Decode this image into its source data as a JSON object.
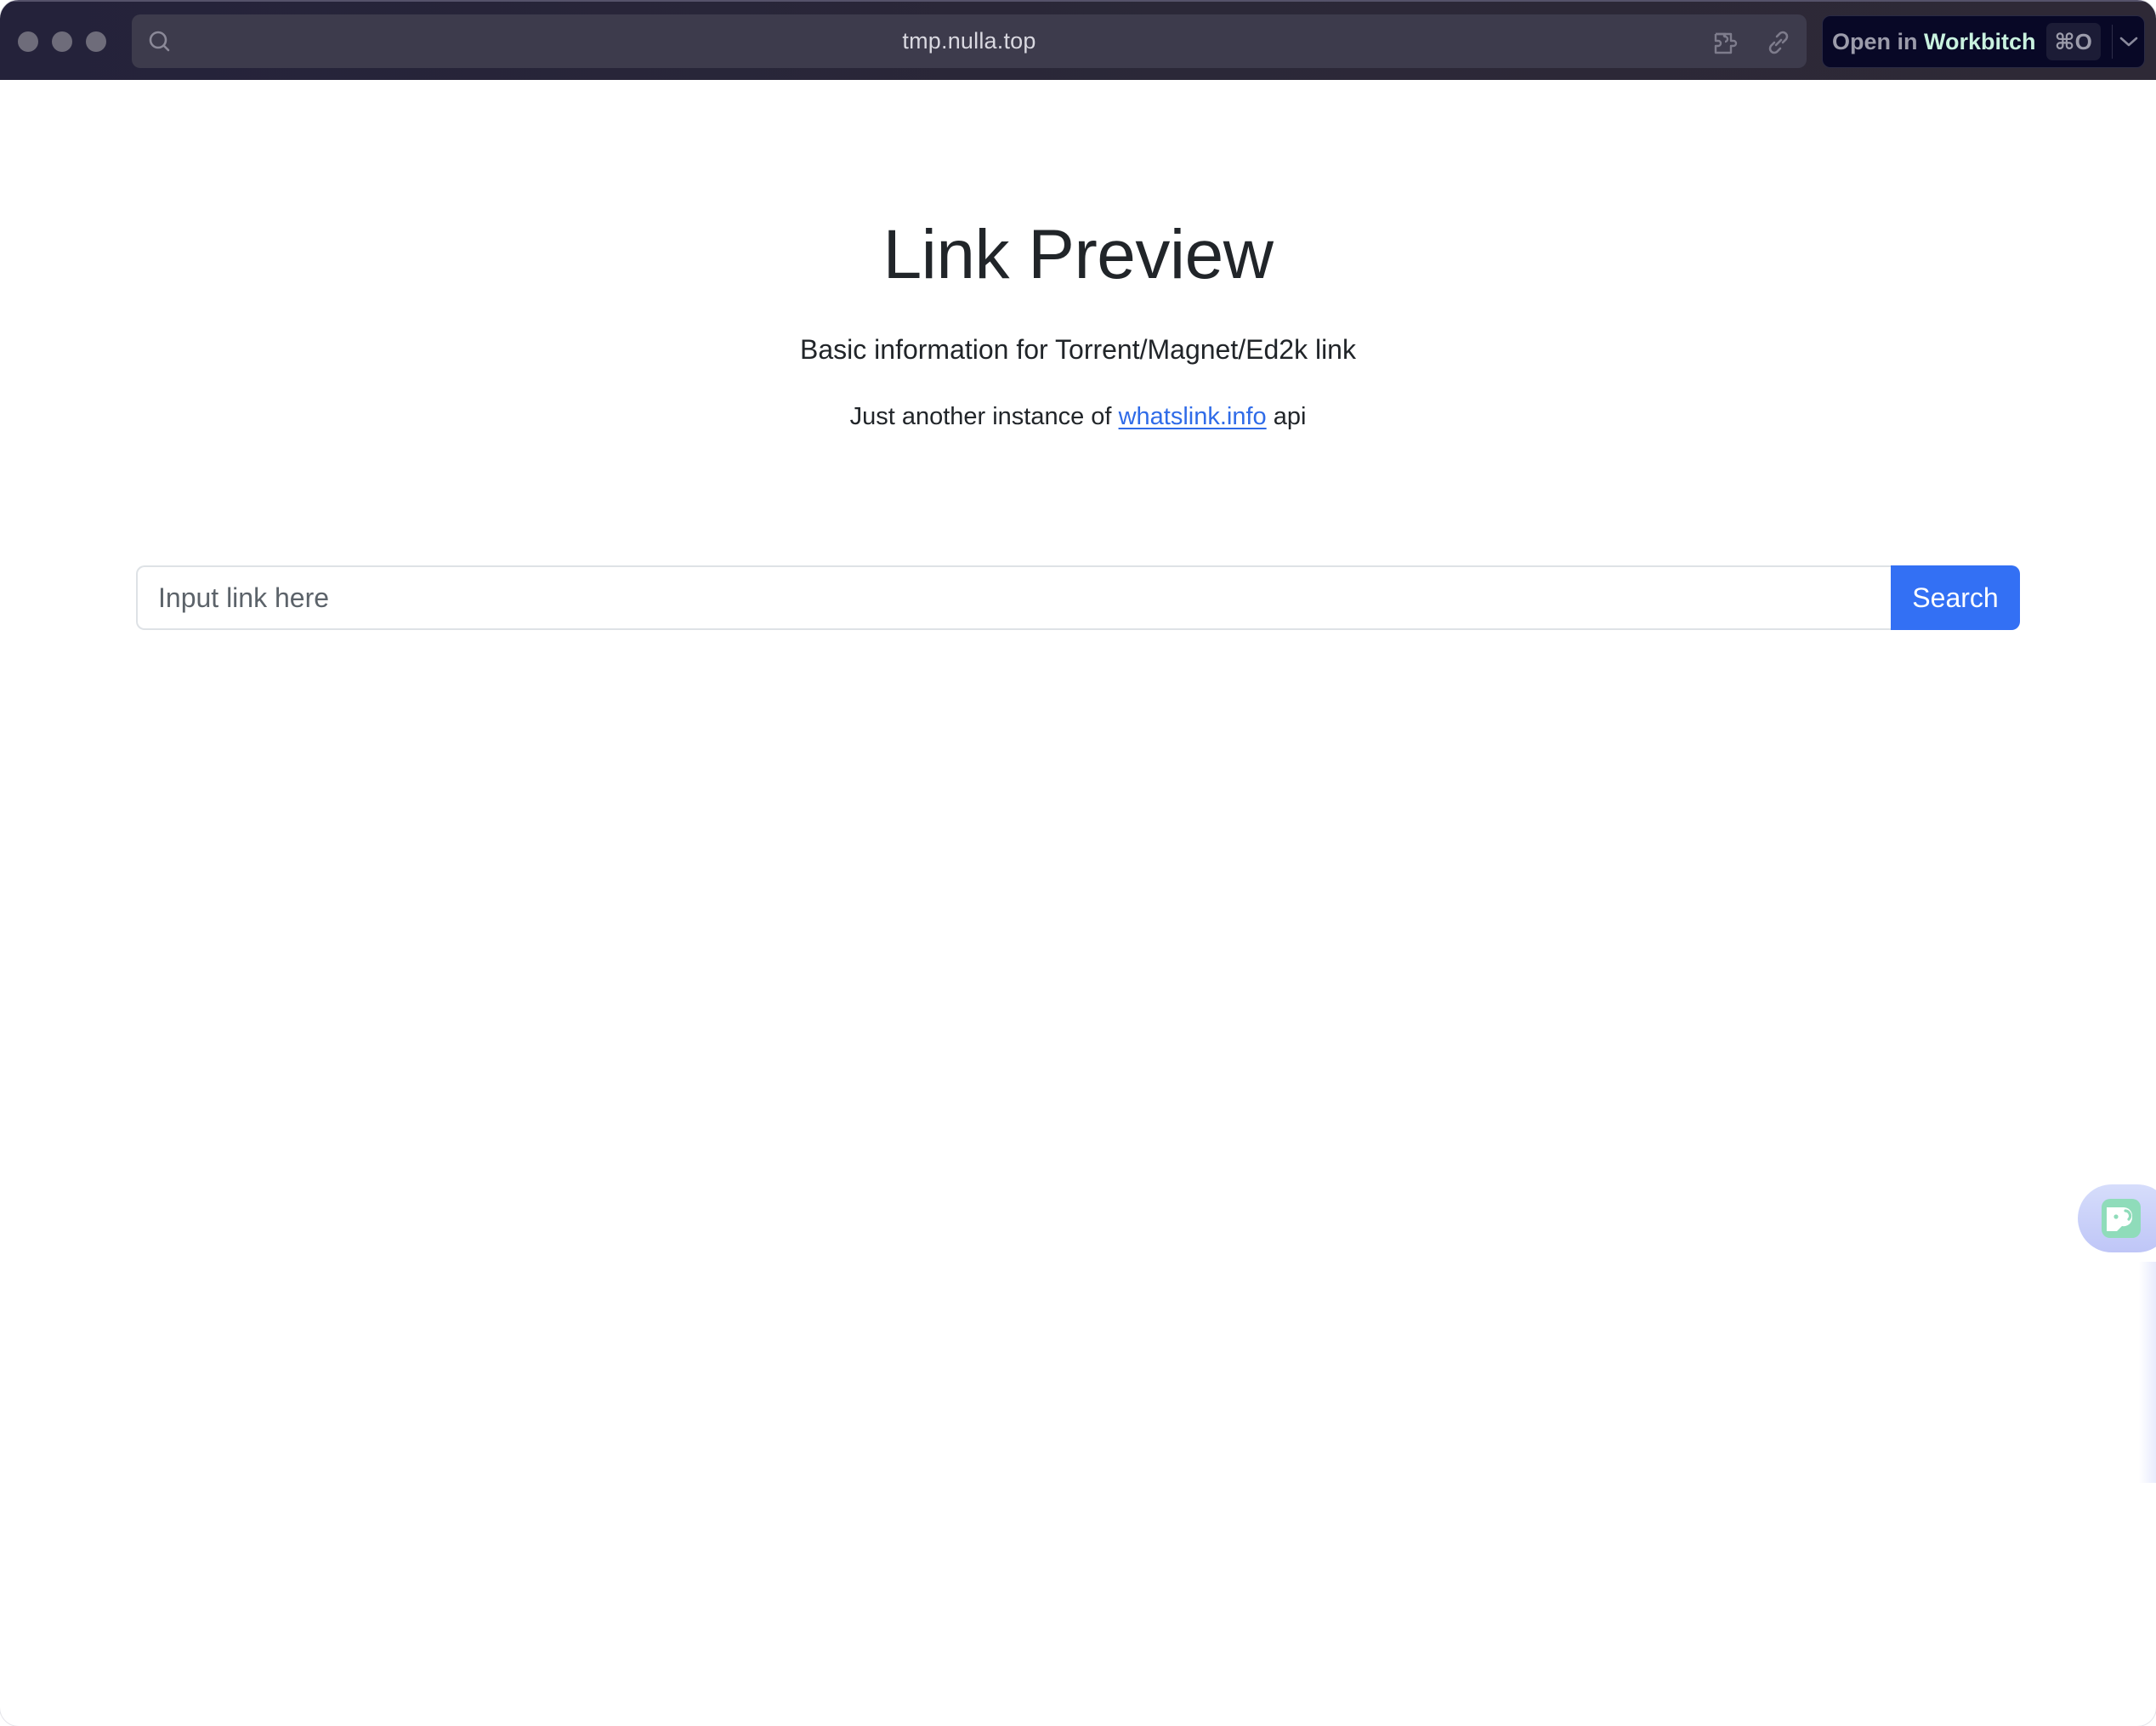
{
  "browser": {
    "url": "tmp.nulla.top",
    "icons": {
      "url_search": "search-icon",
      "extension": "puzzle-icon",
      "copy_link": "link-icon",
      "dropdown": "chevron-down-icon"
    },
    "open_in": {
      "prefix": "Open in ",
      "brand": "Workbitch",
      "shortcut": "⌘O"
    }
  },
  "page": {
    "title": "Link Preview",
    "subtitle": "Basic information for Torrent/Magnet/Ed2k link",
    "note": {
      "before": "Just another instance of ",
      "link_text": "whatslink.info",
      "after": " api"
    },
    "search": {
      "placeholder": "Input link here",
      "value": "",
      "button_label": "Search"
    }
  },
  "floating_widget": {
    "icon": "elephant-icon"
  },
  "colors": {
    "accent": "#3370f4",
    "link": "#2f6be8",
    "text": "#212529",
    "toolbar": "#2b2838",
    "brand_text": "#c9f2df"
  }
}
